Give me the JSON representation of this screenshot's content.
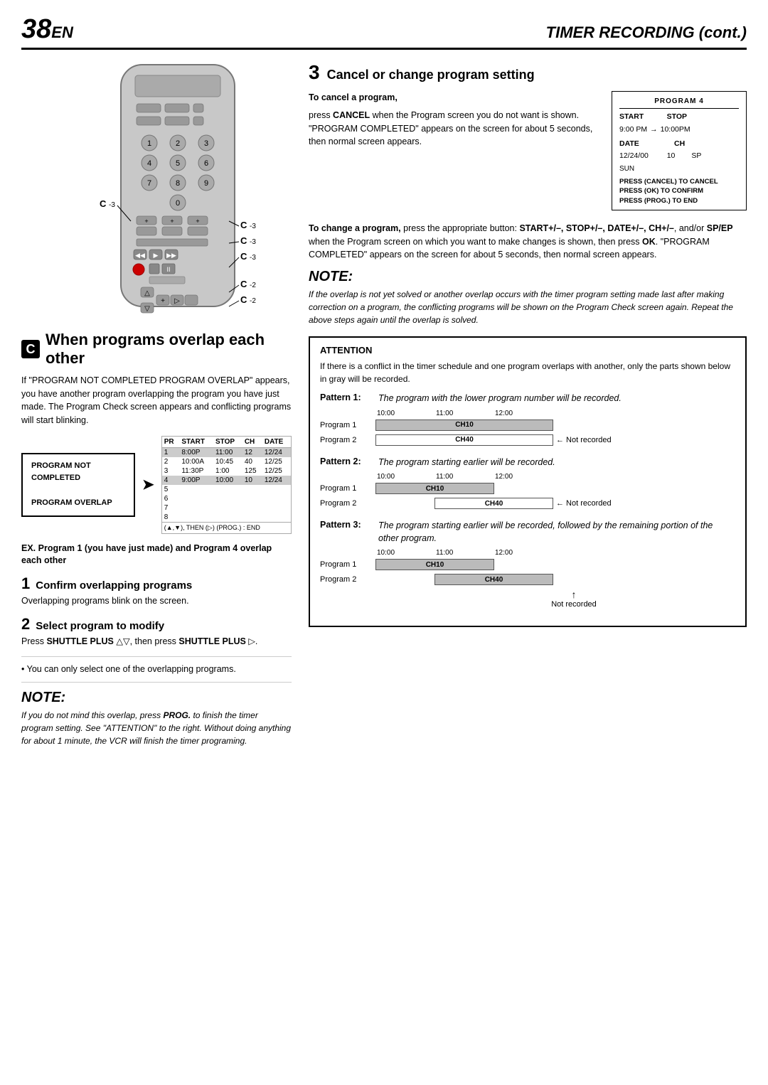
{
  "header": {
    "page_num": "38",
    "en_label": "EN",
    "title": "TIMER RECORDING (cont.)"
  },
  "remote": {
    "c_labels": [
      {
        "id": "c3_left",
        "text": "C",
        "sub": "-3"
      },
      {
        "id": "c3_right1",
        "text": "C",
        "sub": "-3"
      },
      {
        "id": "c3_right2",
        "text": "C",
        "sub": "-3"
      },
      {
        "id": "c3_right3",
        "text": "C",
        "sub": "-3"
      },
      {
        "id": "c2_right1",
        "text": "C",
        "sub": "-2"
      },
      {
        "id": "c2_right2",
        "text": "C",
        "sub": "-2"
      }
    ]
  },
  "section_c": {
    "badge": "C",
    "heading": "When programs overlap each other",
    "body1": "If \"PROGRAM NOT COMPLETED PROGRAM OVERLAP\" appears, you have another program overlapping the program you have just made. The Program Check screen appears and conflicting programs will start blinking.",
    "prog_not_completed": "PROGRAM NOT COMPLETED\n\nPROGRAM OVERLAP",
    "prog_table": {
      "headers": [
        "PR",
        "START",
        "STOP",
        "CH",
        "DATE"
      ],
      "rows": [
        {
          "num": "1",
          "start": "8:00P",
          "stop": "11:00",
          "ch": "12",
          "date": "12/24",
          "highlight": true
        },
        {
          "num": "2",
          "start": "10:00A",
          "stop": "10:45",
          "ch": "40",
          "date": "12/25",
          "highlight": false
        },
        {
          "num": "3",
          "start": "11:30P",
          "stop": "1:00",
          "ch": "125",
          "date": "12/25",
          "highlight": false
        },
        {
          "num": "4",
          "start": "9:00P",
          "stop": "10:00",
          "ch": "10",
          "date": "12/24",
          "highlight": true
        },
        {
          "num": "5",
          "start": "",
          "stop": "",
          "ch": "",
          "date": "",
          "highlight": false
        },
        {
          "num": "6",
          "start": "",
          "stop": "",
          "ch": "",
          "date": "",
          "highlight": false
        },
        {
          "num": "7",
          "start": "",
          "stop": "",
          "ch": "",
          "date": "",
          "highlight": false
        },
        {
          "num": "8",
          "start": "",
          "stop": "",
          "ch": "",
          "date": "",
          "highlight": false
        }
      ],
      "footer": "(▲,▼), THEN (▷) (PROG.) : END"
    },
    "ex_text": "EX. Program 1 (you have just made) and Program 4 overlap each other",
    "step1_num": "1",
    "step1_title": "Confirm overlapping programs",
    "step1_body": "Overlapping programs blink on the screen.",
    "step2_num": "2",
    "step2_title": "Select program to modify",
    "step2_body1": "Press ",
    "step2_bold1": "SHUTTLE PLUS",
    "step2_body2": " △▽, then press ",
    "step2_bold2": "SHUTTLE PLUS",
    "step2_body3": " ▷.",
    "bullet1": "You can only select one of the overlapping programs.",
    "note_title": "NOTE:",
    "note_body": "If you do not mind this overlap, press ",
    "note_bold1": "PROG.",
    "note_body2": " to finish the timer program setting. See \"ATTENTION\" to the right. Without doing anything for about 1 minute, the VCR will finish the timer programing."
  },
  "section3": {
    "num": "3",
    "title": "Cancel or change program setting",
    "cancel_heading": "To cancel a program,",
    "cancel_body1": "press ",
    "cancel_bold1": "CANCEL",
    "cancel_body2": " when the Program screen you do not want is shown. \"PROGRAM COMPLETED\" appears on the screen for about 5 seconds, then normal screen appears.",
    "prog4": {
      "title": "PROGRAM 4",
      "start_label": "START",
      "stop_label": "STOP",
      "start_val": "9:00 PM",
      "arrow": "→",
      "stop_val": "10:00PM",
      "date_label": "DATE",
      "ch_label": "CH",
      "date_val": "12/24/00",
      "ch_val": "10",
      "day_val": "SUN",
      "sp_val": "SP",
      "instruction": "PRESS (CANCEL) TO CANCEL\nPRESS (OK) TO CONFIRM\nPRESS (PROG.) TO END"
    },
    "change_heading": "To change a program,",
    "change_body": "press the appropriate button: START+/–, STOP+/–, DATE+/–, CH+/–, and/or SP/EP when the Program screen on which you want to make changes is shown, then press OK. \"PROGRAM COMPLETED\" appears on the screen for about 5 seconds, then normal screen appears.",
    "note_title": "NOTE:",
    "note_body": "If the overlap is not yet solved or another overlap occurs with the timer program setting made last after making correction on a program, the conflicting programs will be shown on the Program Check screen again. Repeat the above steps again until the overlap is solved.",
    "attention": {
      "title": "ATTENTION",
      "body": "If there is a conflict in the timer schedule and one program overlaps with another, only the parts shown below in gray will be recorded.",
      "pattern1_label": "Pattern 1:",
      "pattern1_desc": "The program with the lower program number will be recorded.",
      "pattern2_label": "Pattern 2:",
      "pattern2_desc": "The program starting earlier will be recorded.",
      "pattern3_label": "Pattern 3:",
      "pattern3_desc": "The program starting earlier will be recorded, followed by the remaining portion of the other program.",
      "time_labels": [
        "10:00",
        "11:00",
        "12:00"
      ],
      "p1_prog1_label": "Program 1",
      "p1_prog1_ch": "CH10",
      "p1_prog2_label": "Program 2",
      "p1_prog2_ch": "CH40",
      "p1_not_recorded": "← Not recorded",
      "p2_prog1_label": "Program 1",
      "p2_prog1_ch": "CH10",
      "p2_prog2_label": "Program 2",
      "p2_prog2_ch": "CH40",
      "p2_not_recorded": "← Not recorded",
      "p3_prog1_label": "Program 1",
      "p3_prog1_ch": "CH10",
      "p3_prog2_label": "Program 2",
      "p3_prog2_ch": "CH40",
      "p3_not_recorded": "Not recorded"
    }
  }
}
